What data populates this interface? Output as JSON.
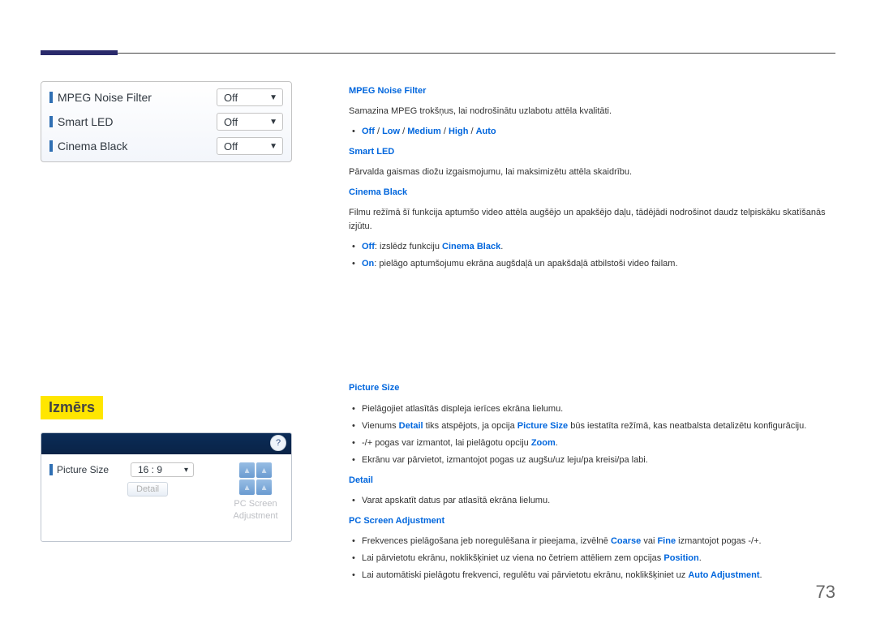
{
  "panel1": {
    "rows": [
      {
        "label": "MPEG Noise Filter",
        "value": "Off"
      },
      {
        "label": "Smart LED",
        "value": "Off"
      },
      {
        "label": "Cinema Black",
        "value": "Off"
      }
    ]
  },
  "panel2": {
    "pictureSizeLabel": "Picture Size",
    "pictureSizeValue": "16 : 9",
    "detailButton": "Detail",
    "pcScreenLabelLine1": "PC Screen",
    "pcScreenLabelLine2": "Adjustment",
    "helpBadge": "?"
  },
  "sectionTitle": "Izmērs",
  "rightTop": {
    "mpegHead": "MPEG Noise Filter",
    "mpegDesc": "Samazina MPEG trokšņus, lai nodrošinātu uzlabotu attēla kvalitāti.",
    "mpegOpt1": "Off",
    "mpegOpt2": "Low",
    "mpegOpt3": "Medium",
    "mpegOpt4": "High",
    "mpegOpt5": "Auto",
    "smartHead": "Smart LED",
    "smartDesc": "Pārvalda gaismas diožu izgaismojumu, lai maksimizētu attēla skaidrību.",
    "cinemaHead": "Cinema Black",
    "cinemaDesc": "Filmu režīmā šī funkcija aptumšo video attēla augšējo un apakšējo daļu, tādējādi nodrošinot daudz telpiskāku skatīšanās izjūtu.",
    "cinemaOffLabel": "Off",
    "cinemaOffText": ": izslēdz funkciju ",
    "cinemaOffTarget": "Cinema Black",
    "cinemaOnLabel": "On",
    "cinemaOnText": ": pielāgo aptumšojumu ekrāna augšdaļā un apakšdaļā atbilstoši video failam."
  },
  "rightBottom": {
    "psHead": "Picture Size",
    "psLi1": "Pielāgojiet atlasītās displeja ierīces ekrāna lielumu.",
    "psLi2a": "Vienums ",
    "psLi2b": "Detail",
    "psLi2c": " tiks atspējots, ja opcija ",
    "psLi2d": "Picture Size",
    "psLi2e": " būs iestatīta režīmā, kas neatbalsta detalizētu konfigurāciju.",
    "psLi3a": "-/+ pogas var izmantot, lai pielāgotu opciju ",
    "psLi3b": "Zoom",
    "psLi4": "Ekrānu var pārvietot, izmantojot pogas uz augšu/uz leju/pa kreisi/pa labi.",
    "detailHead": "Detail",
    "detailLi1": "Varat apskatīt datus par atlasītā ekrāna lielumu.",
    "pcHead": "PC Screen Adjustment",
    "pcLi1a": "Frekvences pielāgošana jeb noregulēšana ir pieejama, izvēlnē ",
    "pcLi1b": "Coarse",
    "pcLi1c": " vai ",
    "pcLi1d": "Fine",
    "pcLi1e": " izmantojot pogas -/+.",
    "pcLi2a": "Lai pārvietotu ekrānu, noklikšķiniet uz viena no četriem attēliem zem opcijas ",
    "pcLi2b": "Position",
    "pcLi3a": "Lai automātiski pielāgotu frekvenci, regulētu vai pārvietotu ekrānu, noklikšķiniet uz ",
    "pcLi3b": "Auto Adjustment"
  },
  "pageNumber": "73"
}
